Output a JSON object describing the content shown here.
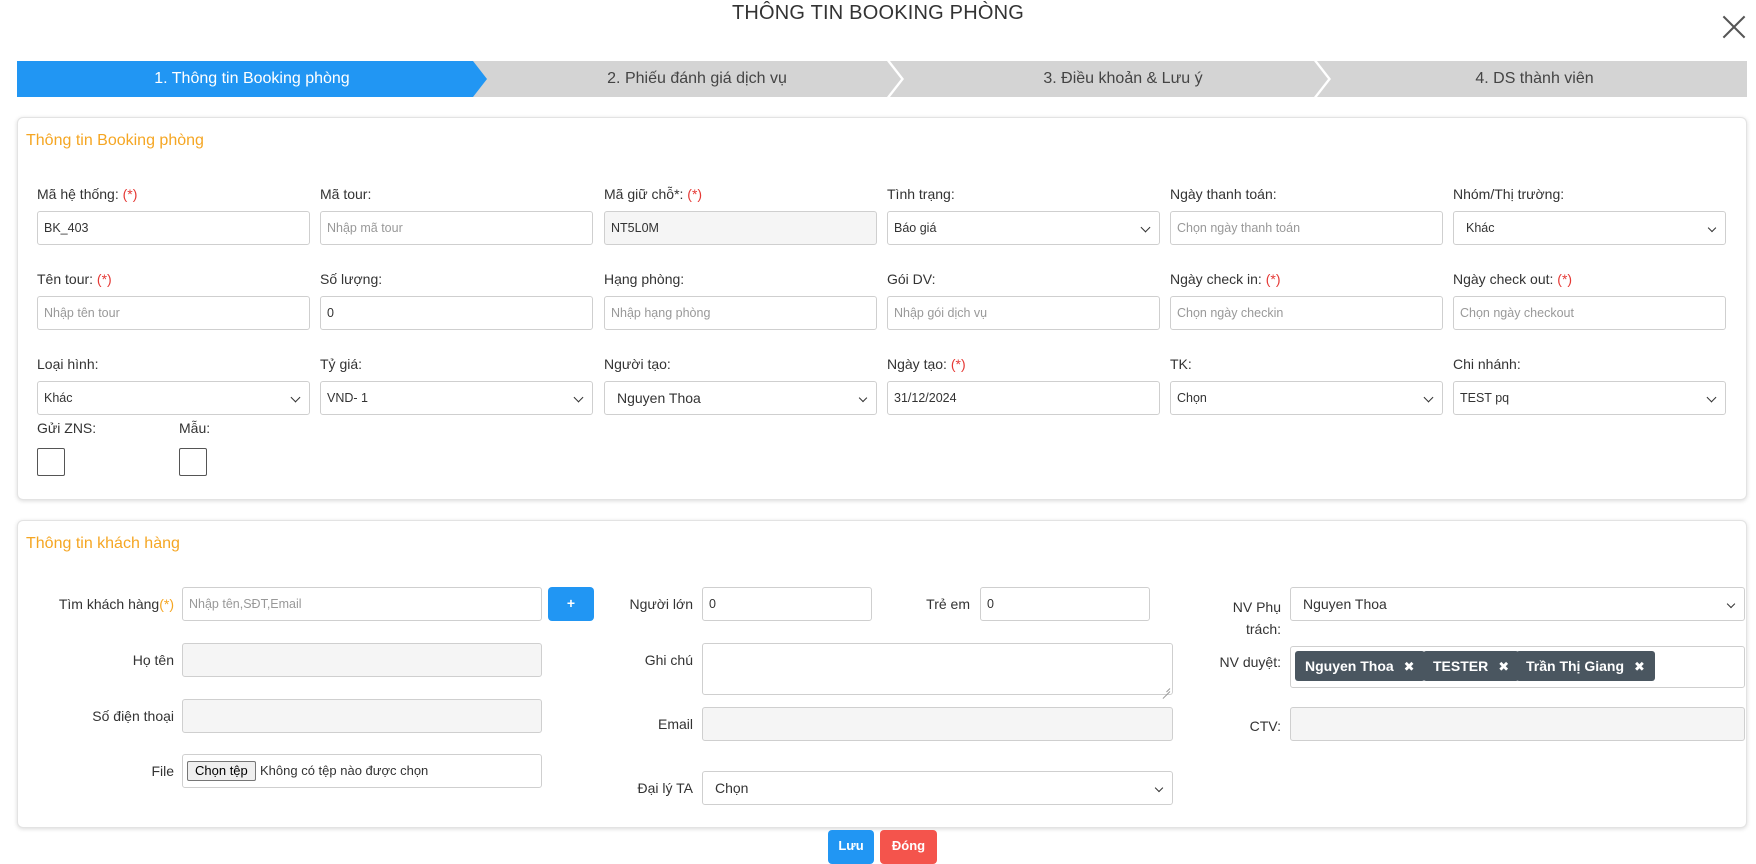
{
  "modal": {
    "title": "THÔNG TIN BOOKING PHÒNG"
  },
  "steps": [
    {
      "label": "1. Thông tin Booking phòng",
      "active": true
    },
    {
      "label": "2. Phiếu đánh giá dịch vụ",
      "active": false
    },
    {
      "label": "3. Điều khoản & Lưu ý",
      "active": false
    },
    {
      "label": "4. DS thành viên",
      "active": false
    }
  ],
  "booking": {
    "section_title": "Thông tin Booking phòng",
    "required_mark": "(*)",
    "ma_he_thong": {
      "label": "Mã hệ thống:",
      "value": "BK_403"
    },
    "ma_tour": {
      "label": "Mã tour:",
      "placeholder": "Nhập mã tour"
    },
    "ma_giu_cho": {
      "label": "Mã giữ chỗ*:",
      "value": "NT5L0M"
    },
    "tinh_trang": {
      "label": "Tình trạng:",
      "value": "Báo giá"
    },
    "ngay_thanh_toan": {
      "label": "Ngày thanh toán:",
      "placeholder": "Chọn ngày thanh toán"
    },
    "nhom_thi_truong": {
      "label": "Nhóm/Thị trường:",
      "value": "Khác"
    },
    "ten_tour": {
      "label": "Tên tour:",
      "placeholder": "Nhập tên tour"
    },
    "so_luong": {
      "label": "Số lượng:",
      "value": "0"
    },
    "hang_phong": {
      "label": "Hạng phòng:",
      "placeholder": "Nhập hạng phòng"
    },
    "goi_dv": {
      "label": "Gói DV:",
      "placeholder": "Nhập gói dịch vụ"
    },
    "ngay_check_in": {
      "label": "Ngày check in:",
      "placeholder": "Chọn ngày checkin"
    },
    "ngay_check_out": {
      "label": "Ngày check out:",
      "placeholder": "Chọn ngày checkout"
    },
    "loai_hinh": {
      "label": "Loại hình:",
      "value": "Khác"
    },
    "ty_gia": {
      "label": "Tỷ giá:",
      "value": "VND- 1"
    },
    "nguoi_tao": {
      "label": "Người tạo:",
      "value": "Nguyen Thoa"
    },
    "ngay_tao": {
      "label": "Ngày tạo:",
      "value": "31/12/2024"
    },
    "tk": {
      "label": "TK:",
      "value": "Chọn"
    },
    "chi_nhanh": {
      "label": "Chi nhánh:",
      "value": "TEST pq"
    },
    "gui_zns": {
      "label": "Gửi ZNS:",
      "checked": false
    },
    "mau": {
      "label": "Mẫu:",
      "checked": false
    }
  },
  "customer": {
    "section_title": "Thông tin khách hàng",
    "tim_khach_hang": {
      "label": "Tìm khách hàng",
      "required": "(*)",
      "placeholder": "Nhập tên,SĐT,Email",
      "add_label": "+"
    },
    "ho_ten": {
      "label": "Họ tên"
    },
    "so_dien_thoai": {
      "label": "Số điện thoại"
    },
    "file": {
      "label": "File",
      "button": "Chọn tệp",
      "status": "Không có tệp nào được chọn"
    },
    "nguoi_lon": {
      "label": "Người lớn",
      "value": "0"
    },
    "tre_em": {
      "label": "Trẻ em",
      "value": "0"
    },
    "ghi_chu": {
      "label": "Ghi chú"
    },
    "email": {
      "label": "Email"
    },
    "dai_ly_ta": {
      "label": "Đại lý TA",
      "value": "Chọn"
    },
    "nv_phu_trach": {
      "label_line1": "NV Phụ",
      "label_line2": "trách:",
      "value": "Nguyen Thoa"
    },
    "nv_duyet": {
      "label": "NV duyệt:",
      "tags": [
        "Nguyen Thoa",
        "TESTER",
        "Trần Thị Giang"
      ],
      "remove_glyph": "✖"
    },
    "ctv": {
      "label": "CTV:"
    }
  },
  "footer": {
    "save_label": "Lưu",
    "close_label": "Đóng"
  },
  "colors": {
    "primary": "#2196f3",
    "accent": "#f5a623",
    "danger": "#f4544c",
    "tag": "#4a5660"
  }
}
